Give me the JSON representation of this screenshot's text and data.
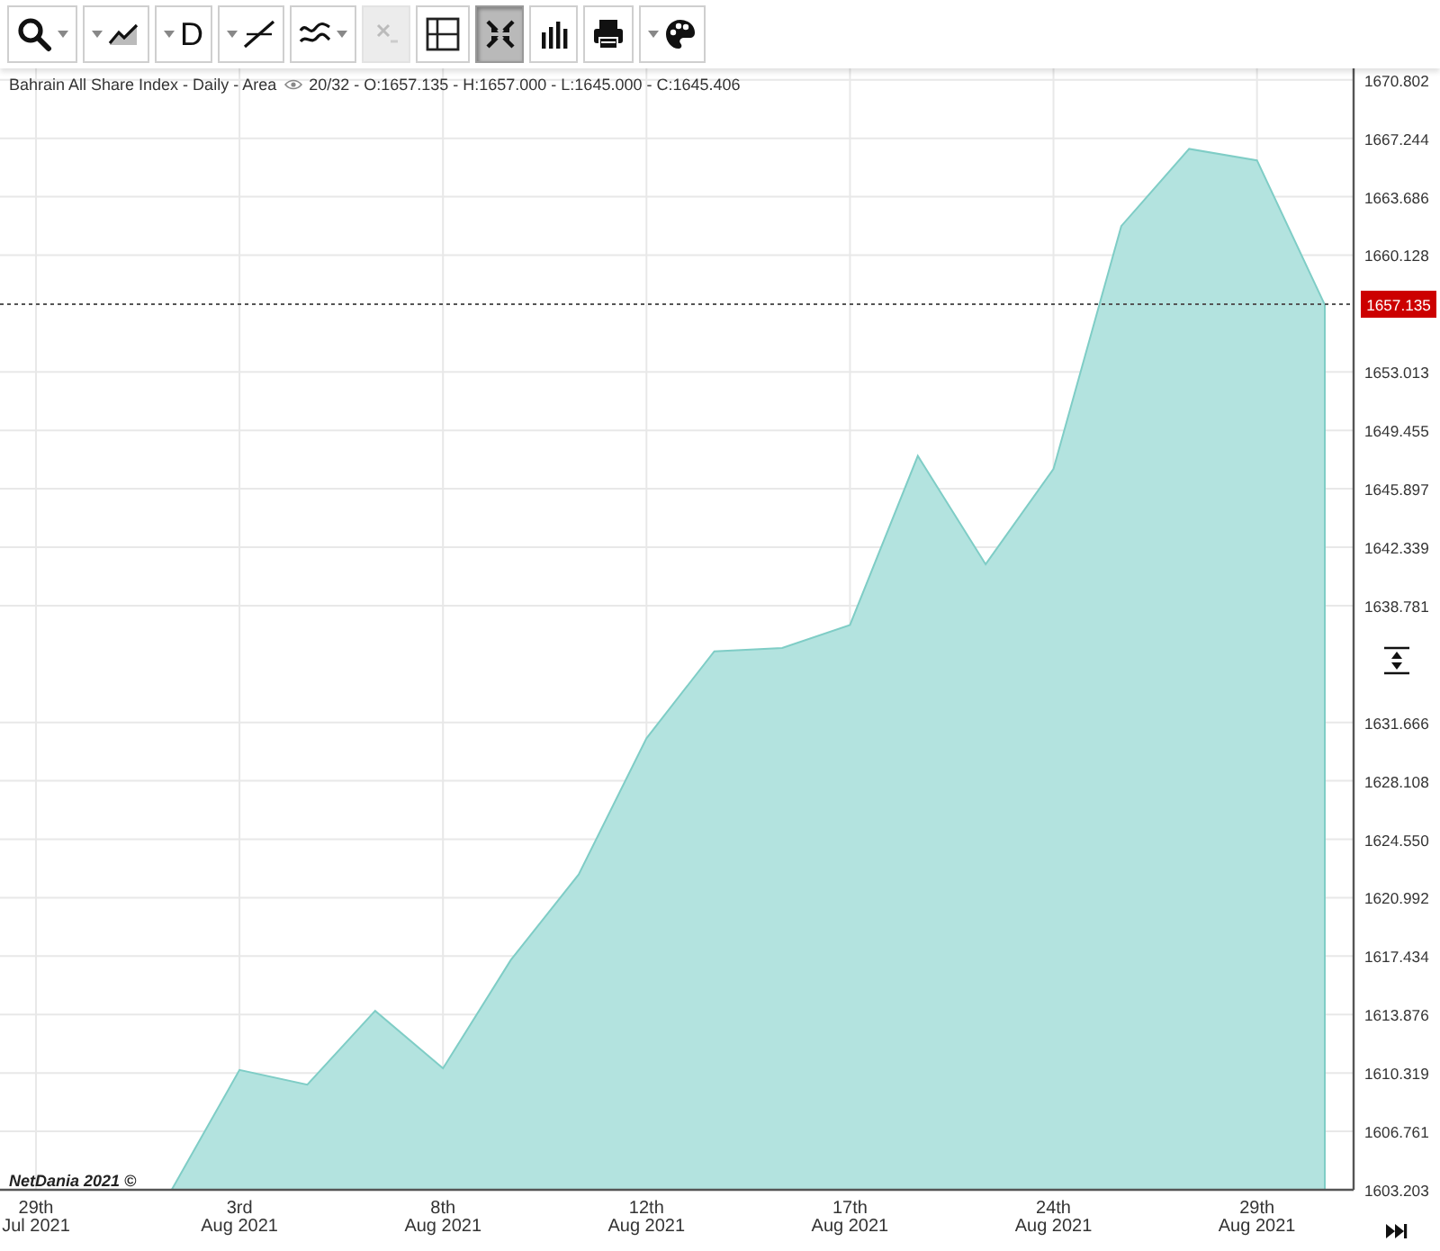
{
  "toolbar": [
    {
      "kind": "zoom",
      "dropdown": true,
      "caret_first": false,
      "selected": false,
      "disabled": false
    },
    {
      "kind": "area-style",
      "dropdown": true,
      "caret_first": true,
      "selected": false,
      "disabled": false
    },
    {
      "kind": "text",
      "label": "D",
      "dropdown": true,
      "caret_first": true,
      "selected": false,
      "disabled": false
    },
    {
      "kind": "line-tool",
      "dropdown": true,
      "caret_first": true,
      "selected": false,
      "disabled": false
    },
    {
      "kind": "studies",
      "dropdown": true,
      "caret_first": false,
      "selected": false,
      "disabled": false
    },
    {
      "kind": "remove",
      "dropdown": false,
      "selected": false,
      "disabled": true
    },
    {
      "kind": "crosshair",
      "dropdown": false,
      "selected": false,
      "disabled": false
    },
    {
      "kind": "fit",
      "dropdown": false,
      "selected": true,
      "disabled": false
    },
    {
      "kind": "volume",
      "dropdown": false,
      "selected": false,
      "disabled": false
    },
    {
      "kind": "print",
      "dropdown": false,
      "selected": false,
      "disabled": false
    },
    {
      "kind": "palette",
      "dropdown": true,
      "caret_first": true,
      "selected": false,
      "disabled": false
    }
  ],
  "chart": {
    "title": "Bahrain All Share Index - Daily - Area",
    "stats": "20/32 - O:1657.135 - H:1657.000 - L:1645.000 - C:1645.406",
    "credit": "NetDania 2021 ©",
    "chart_data": {
      "type": "area",
      "categories": [
        "29th\nJul 2021",
        null,
        null,
        "3rd\nAug 2021",
        null,
        null,
        "8th\nAug 2021",
        null,
        null,
        "12th\nAug 2021",
        null,
        null,
        "17th\nAug 2021",
        null,
        null,
        "24th\nAug 2021",
        null,
        null,
        "29th\nAug 2021",
        null
      ],
      "series": [
        {
          "color": "#b3e3df",
          "values": [
            null,
            null,
            1603.2,
            1610.5,
            1609.6,
            1614.1,
            1610.6,
            1617.2,
            1622.4,
            1630.7,
            1636.0,
            1636.2,
            1637.6,
            1647.9,
            1641.3,
            1647.1,
            1661.9,
            1666.6,
            1665.9,
            1657.1
          ]
        }
      ],
      "ylim": [
        1603.2,
        1671.5
      ],
      "grid": true,
      "ref_lines": [
        {
          "axis": "y",
          "value": 1657.135,
          "label": "1657.135"
        }
      ],
      "yticks": [
        {
          "value": 1670.802,
          "label": "1670.802"
        },
        {
          "value": 1667.244,
          "label": "1667.244"
        },
        {
          "value": 1663.686,
          "label": "1663.686"
        },
        {
          "value": 1660.128,
          "label": "1660.128"
        },
        {
          "value": 1653.013,
          "label": "1653.013"
        },
        {
          "value": 1649.455,
          "label": "1649.455"
        },
        {
          "value": 1645.897,
          "label": "1645.897"
        },
        {
          "value": 1642.339,
          "label": "1642.339"
        },
        {
          "value": 1638.781,
          "label": "1638.781"
        },
        {
          "value": 1631.666,
          "label": "1631.666"
        },
        {
          "value": 1628.108,
          "label": "1628.108"
        },
        {
          "value": 1624.55,
          "label": "1624.550"
        },
        {
          "value": 1620.992,
          "label": "1620.992"
        },
        {
          "value": 1617.434,
          "label": "1617.434"
        },
        {
          "value": 1613.876,
          "label": "1613.876"
        },
        {
          "value": 1610.319,
          "label": "1610.319"
        },
        {
          "value": 1606.761,
          "label": "1606.761"
        },
        {
          "value": 1603.203,
          "label": "1603.203"
        }
      ]
    }
  }
}
